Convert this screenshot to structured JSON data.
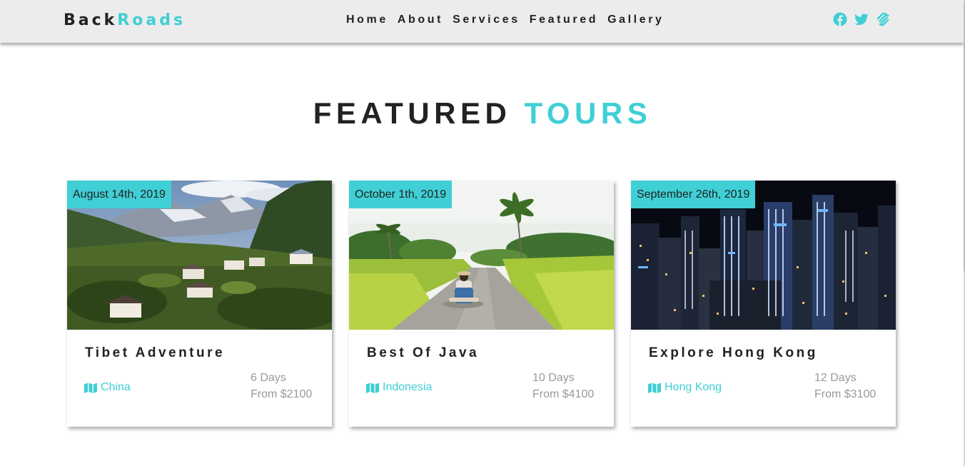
{
  "navbar": {
    "logo_part1": "Back",
    "logo_part2": "Roads",
    "links": [
      "Home",
      "About",
      "Services",
      "Featured",
      "Gallery"
    ],
    "social_icons": [
      "facebook-icon",
      "twitter-icon",
      "squarespace-icon"
    ]
  },
  "section": {
    "title_part1": "FEATURED",
    "title_part2": "TOURS"
  },
  "tours": [
    {
      "date": "August 14th, 2019",
      "title": "Tibet Adventure",
      "location": "China",
      "duration": "6 Days",
      "price": "From $2100",
      "image_icon": "mountain-village-image"
    },
    {
      "date": "October 1th, 2019",
      "title": "Best Of Java",
      "location": "Indonesia",
      "duration": "10 Days",
      "price": "From $4100",
      "image_icon": "tropical-road-image"
    },
    {
      "date": "September 26th, 2019",
      "title": "Explore Hong Kong",
      "location": "Hong Kong",
      "duration": "12 Days",
      "price": "From $3100",
      "image_icon": "city-night-image"
    }
  ],
  "colors": {
    "accent": "#3fcfd5",
    "text": "#222222",
    "muted": "#999999",
    "navbar_bg": "#ececec"
  }
}
